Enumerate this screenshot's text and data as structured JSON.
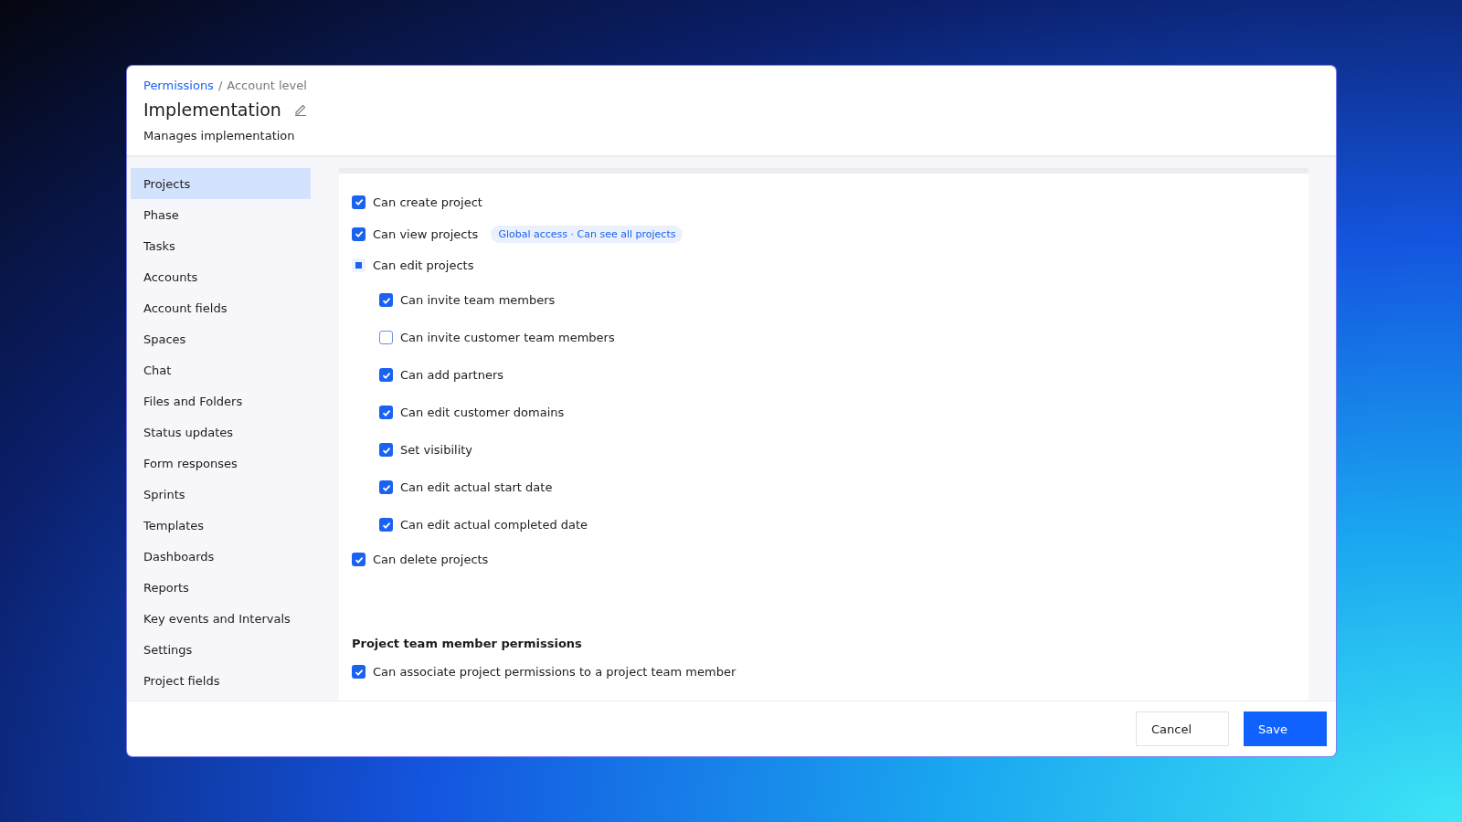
{
  "breadcrumb": {
    "link": "Permissions",
    "separator": "/",
    "current": "Account level"
  },
  "title": "Implementation",
  "subtitle": "Manages implementation",
  "sidebar": {
    "items": [
      {
        "label": "Projects",
        "selected": true
      },
      {
        "label": "Phase",
        "selected": false
      },
      {
        "label": "Tasks",
        "selected": false
      },
      {
        "label": "Accounts",
        "selected": false
      },
      {
        "label": "Account fields",
        "selected": false
      },
      {
        "label": "Spaces",
        "selected": false
      },
      {
        "label": "Chat",
        "selected": false
      },
      {
        "label": "Files and Folders",
        "selected": false
      },
      {
        "label": "Status updates",
        "selected": false
      },
      {
        "label": "Form responses",
        "selected": false
      },
      {
        "label": "Sprints",
        "selected": false
      },
      {
        "label": "Templates",
        "selected": false
      },
      {
        "label": "Dashboards",
        "selected": false
      },
      {
        "label": "Reports",
        "selected": false
      },
      {
        "label": "Key events and Intervals",
        "selected": false
      },
      {
        "label": "Settings",
        "selected": false
      },
      {
        "label": "Project fields",
        "selected": false
      }
    ]
  },
  "permissions": [
    {
      "label": "Can create project",
      "checked": true,
      "indeterminate": false
    },
    {
      "label": "Can view projects",
      "checked": true,
      "indeterminate": false,
      "badge": "Global access · Can see all projects"
    },
    {
      "label": "Can edit projects",
      "indeterminate": true,
      "children": [
        {
          "label": "Can invite team members",
          "checked": true,
          "indeterminate": false
        },
        {
          "label": "Can invite customer team members",
          "checked": false,
          "indeterminate": false
        },
        {
          "label": "Can add partners",
          "checked": true,
          "indeterminate": false
        },
        {
          "label": "Can edit customer domains",
          "checked": true,
          "indeterminate": false
        },
        {
          "label": "Set visibility",
          "checked": true,
          "indeterminate": false
        },
        {
          "label": "Can edit actual start date",
          "checked": true,
          "indeterminate": false
        },
        {
          "label": "Can edit actual completed date",
          "checked": true,
          "indeterminate": false
        }
      ]
    },
    {
      "label": "Can delete projects",
      "checked": true,
      "indeterminate": false
    }
  ],
  "team_section": {
    "heading": "Project team member permissions",
    "permissions": [
      {
        "label": "Can associate project permissions to a project team member",
        "checked": true,
        "indeterminate": false
      }
    ]
  },
  "buttons": {
    "cancel": "Cancel",
    "save": "Save"
  }
}
